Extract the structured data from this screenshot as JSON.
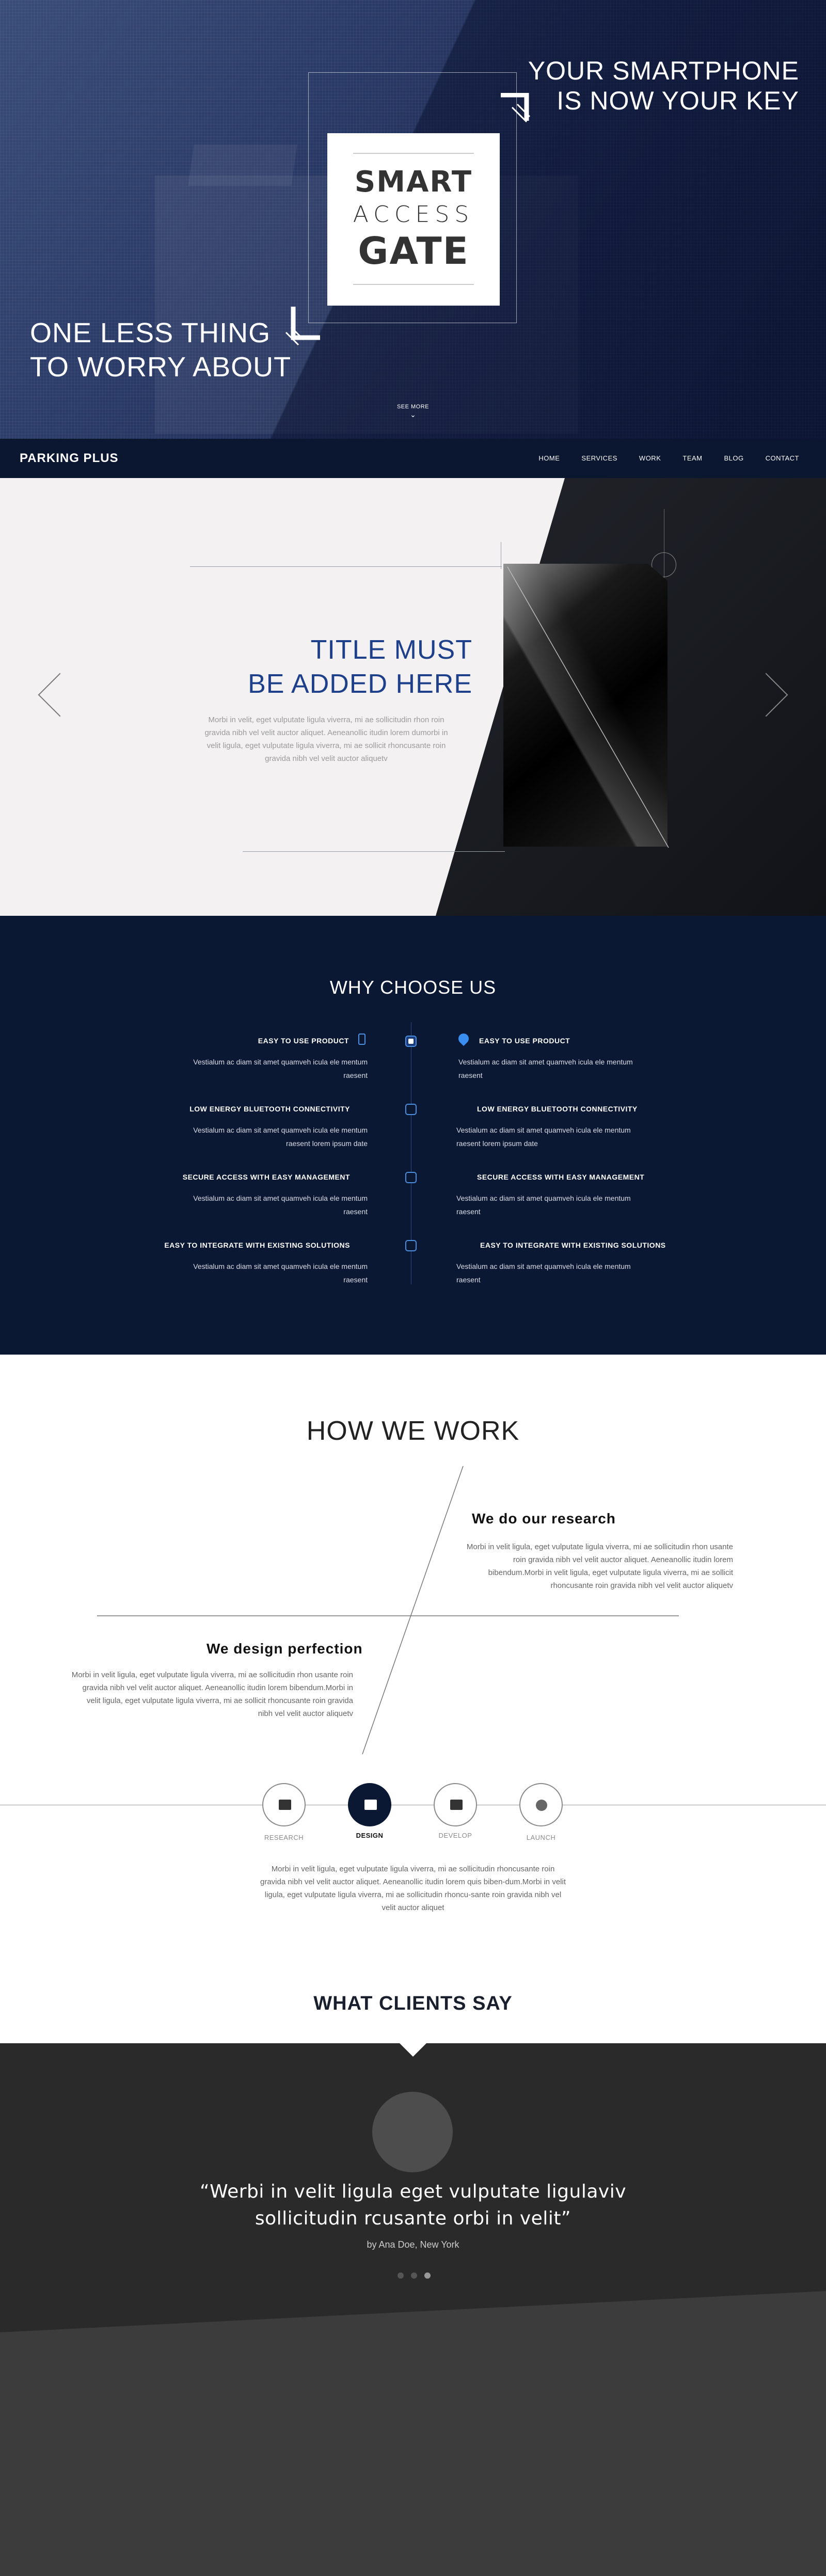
{
  "hero": {
    "tagline_right_1": "YOUR SMARTPHONE",
    "tagline_right_2": "IS NOW YOUR KEY",
    "tagline_left_1": "ONE LESS THING",
    "tagline_left_2": "TO WORRY ABOUT",
    "logo_line1": "SMART",
    "logo_line2": "ACCESS",
    "logo_line3": "GATE",
    "see_more": "SEE MORE"
  },
  "nav": {
    "brand": "PARKING PLUS",
    "items": [
      "HOME",
      "SERVICES",
      "WORK",
      "TEAM",
      "BLOG",
      "CONTACT"
    ]
  },
  "slider": {
    "title_1": "TITLE MUST",
    "title_2": "BE ADDED HERE",
    "body": "Morbi in velit, eget vulputate ligula viverra, mi ae sollicitudin rhon roin gravida nibh vel velit auctor aliquet.  Aeneanollic itudin lorem dumorbi in velit ligula, eget vulputate ligula viverra, mi ae sollicit rhoncusante roin gravida nibh vel velit auctor aliquetv"
  },
  "why": {
    "heading": "WHY CHOOSE US",
    "left": [
      {
        "title": "EASY TO USE PRODUCT",
        "body": "Vestialum ac diam sit amet quamveh icula ele mentum raesent"
      },
      {
        "title": "LOW ENERGY BLUETOOTH CONNECTIVITY",
        "body": "Vestialum ac diam sit amet quamveh icula ele mentum raesent lorem ipsum date"
      },
      {
        "title": "SECURE ACCESS WITH EASY MANAGEMENT",
        "body": "Vestialum ac diam sit amet quamveh icula ele mentum raesent"
      },
      {
        "title": "EASY TO INTEGRATE WITH EXISTING SOLUTIONS",
        "body": "Vestialum ac diam sit amet quamveh icula ele mentum raesent"
      }
    ],
    "right": [
      {
        "title": "EASY TO USE PRODUCT",
        "body": "Vestialum ac diam sit amet quamveh icula ele mentum raesent"
      },
      {
        "title": "LOW ENERGY BLUETOOTH CONNECTIVITY",
        "body": "Vestialum ac diam sit amet quamveh icula ele mentum raesent lorem ipsum date"
      },
      {
        "title": "SECURE ACCESS WITH EASY MANAGEMENT",
        "body": "Vestialum ac diam sit amet quamveh icula ele mentum raesent"
      },
      {
        "title": "EASY TO INTEGRATE WITH EXISTING SOLUTIONS",
        "body": "Vestialum ac diam sit amet quamveh icula ele mentum raesent"
      }
    ]
  },
  "how": {
    "heading": "HOW WE WORK",
    "research_title": "We do our research",
    "research_body": "Morbi in velit ligula, eget vulputate ligula viverra, mi ae sollicitudin rhon usante roin gravida nibh vel velit auctor aliquet. Aeneanollic itudin lorem bibendum.Morbi in velit ligula, eget vulputate ligula viverra, mi ae sollicit rhoncusante roin gravida nibh vel velit auctor aliquetv",
    "design_title": "We design perfection",
    "design_body": "Morbi in velit ligula, eget vulputate ligula viverra, mi ae sollicitudin rhon usante roin gravida nibh vel velit auctor aliquet. Aeneanollic itudin lorem bibendum.Morbi in velit ligula, eget vulputate ligula viverra, mi ae sollicit rhoncusante roin gravida nibh vel velit auctor aliquetv",
    "steps": [
      "RESEARCH",
      "DESIGN",
      "DEVELOP",
      "LAUNCH"
    ],
    "active_step": "DESIGN",
    "step_body": "Morbi in velit ligula, eget vulputate ligula viverra, mi ae sollicitudin rhoncusante roin gravida nibh vel velit auctor aliquet. Aeneanollic itudin lorem quis biben-dum.Morbi in velit ligula, eget vulputate ligula viverra, mi ae sollicitudin rhoncu-sante roin gravida nibh vel velit auctor aliquet"
  },
  "clients": {
    "heading": "WHAT CLIENTS SAY",
    "quote_1": "“Werbi in velit ligula eget vulputate ligulaviv",
    "quote_2": "sollicitudin rcusante orbi in velit”",
    "author": "by Ana Doe, New York",
    "active_dot": 3
  },
  "colors": {
    "navy": "#0b1833",
    "accent_blue": "#1e3f8a",
    "dot_blue": "#4a8fe0",
    "dark_gray": "#2a2a2a"
  }
}
